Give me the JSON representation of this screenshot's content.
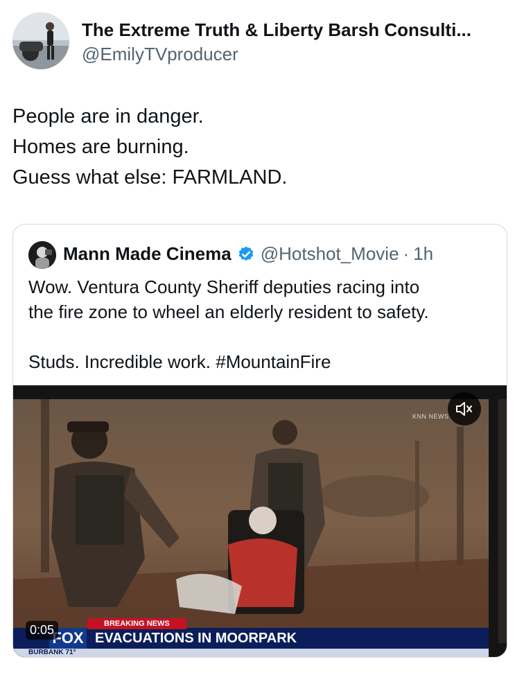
{
  "tweet": {
    "display_name": "The Extreme Truth & Liberty Barsh Consulti...",
    "handle": "@EmilyTVproducer",
    "text_lines": [
      "People are in danger.",
      "Homes are burning.",
      "Guess what else: FARMLAND."
    ]
  },
  "quote": {
    "display_name": "Mann Made Cinema",
    "handle": "@Hotshot_Movie",
    "separator": "·",
    "time": "1h",
    "text_lines": [
      "Wow. Ventura County Sheriff deputies racing into",
      "the fire zone to wheel an elderly resident to safety."
    ],
    "text_line_3": "Studs. Incredible work. #MountainFire",
    "verified_icon": "verified-badge-icon",
    "video": {
      "timestamp": "0:05",
      "watermark": "KNN NEWS",
      "breaking_label": "BREAKING NEWS",
      "channel": "FOX 11",
      "headline": "EVACUATIONS IN MOORPARK",
      "ticker": "BURBANK  71°",
      "mute_icon": "speaker-muted-icon"
    }
  },
  "colors": {
    "text_primary": "#0f1419",
    "text_secondary": "#536471",
    "verified_blue": "#1d9bf0",
    "news_blue": "#0b1e5b",
    "breaking_red": "#c41224"
  }
}
